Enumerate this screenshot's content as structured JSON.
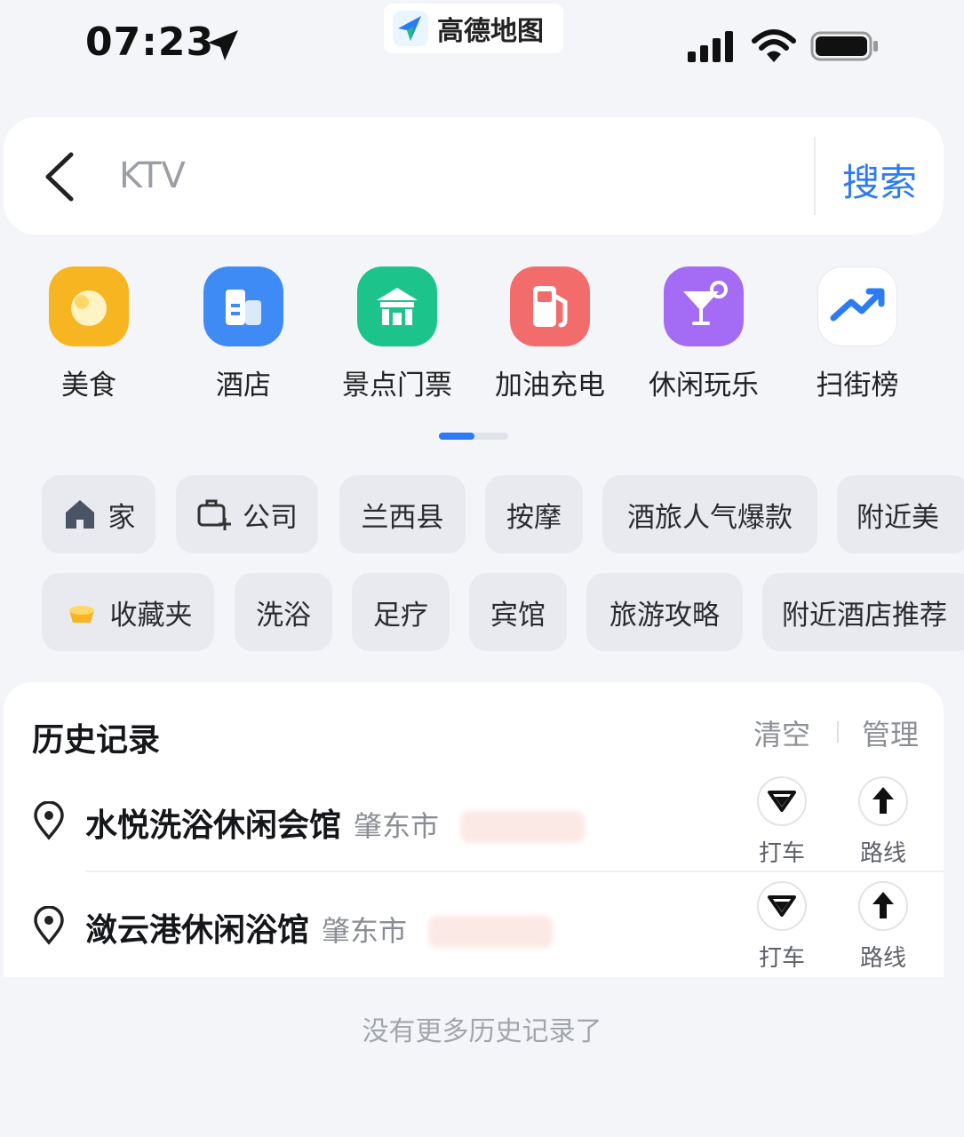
{
  "status_bar": {
    "time": "07:23",
    "app_name": "高德地图",
    "icons": [
      "location-arrow-icon",
      "amap-logo-icon",
      "signal-icon",
      "wifi-icon",
      "battery-icon"
    ]
  },
  "search": {
    "placeholder": "KTV",
    "button_label": "搜索",
    "accent_color": "#2d7bf4"
  },
  "categories": [
    {
      "label": "美食",
      "icon": "food-icon",
      "color": "#f7b521"
    },
    {
      "label": "酒店",
      "icon": "hotel-icon",
      "color": "#3f8bf6"
    },
    {
      "label": "景点门票",
      "icon": "attraction-icon",
      "color": "#1cc48b"
    },
    {
      "label": "加油充电",
      "icon": "fuel-icon",
      "color": "#f26c6c"
    },
    {
      "label": "休闲玩乐",
      "icon": "cocktail-icon",
      "color": "#a46cf4"
    },
    {
      "label": "扫街榜",
      "icon": "trend-icon",
      "color": "#ffffff"
    }
  ],
  "page_indicator": {
    "pages": 2,
    "current": 1
  },
  "chips_row1": [
    {
      "label": "家",
      "icon": "home-icon"
    },
    {
      "label": "公司",
      "icon": "briefcase-add-icon"
    },
    {
      "label": "兰西县"
    },
    {
      "label": "按摩"
    },
    {
      "label": "酒旅人气爆款"
    },
    {
      "label": "附近美"
    }
  ],
  "chips_row2": [
    {
      "label": "收藏夹",
      "icon": "favorites-icon"
    },
    {
      "label": "洗浴"
    },
    {
      "label": "足疗"
    },
    {
      "label": "宾馆"
    },
    {
      "label": "旅游攻略"
    },
    {
      "label": "附近酒店推荐"
    }
  ],
  "history": {
    "title": "历史记录",
    "clear_label": "清空",
    "manage_label": "管理",
    "items": [
      {
        "name": "水悦洗浴休闲会馆",
        "city": "肇东市",
        "taxi_label": "打车",
        "route_label": "路线"
      },
      {
        "name": "潋云港休闲浴馆",
        "city": "肇东市",
        "taxi_label": "打车",
        "route_label": "路线"
      }
    ],
    "empty_text": "没有更多历史记录了"
  }
}
